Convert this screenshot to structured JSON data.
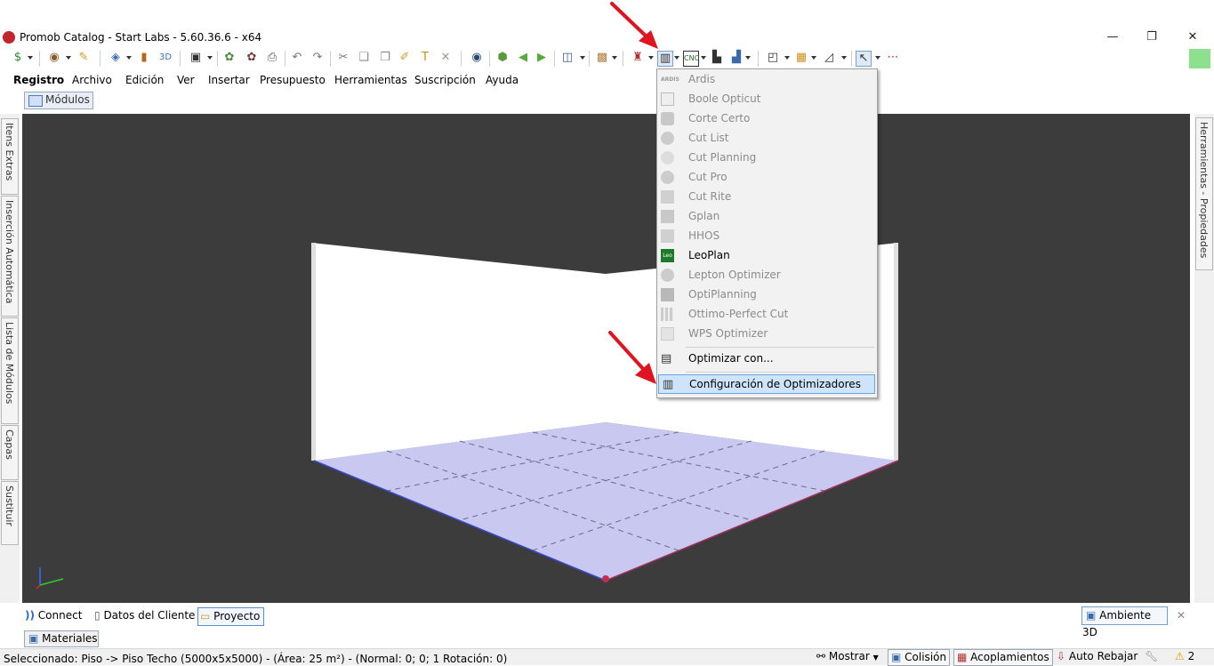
{
  "window": {
    "title": "Promob Catalog - Start Labs - 5.60.36.6 - x64",
    "controls": [
      "—",
      "❐",
      "✕"
    ]
  },
  "menubar": [
    "Registro",
    "Archivo",
    "Edición",
    "Ver",
    "Insertar",
    "Presupuesto",
    "Herramientas",
    "Suscripción",
    "Ayuda"
  ],
  "top_tab": "Módulos",
  "left_tabs": [
    "Itens Extras",
    "Inserción Automática",
    "Lista de Módulos",
    "Capas",
    "Sustituir"
  ],
  "right_tab": "Herramientas - Propiedades",
  "dropdown": {
    "items": [
      {
        "label": "Ardis",
        "enabled": false,
        "icon": "ardis-icon"
      },
      {
        "label": "Boole Opticut",
        "enabled": false,
        "icon": "boole-icon"
      },
      {
        "label": "Corte Certo",
        "enabled": false,
        "icon": "corte-certo-icon"
      },
      {
        "label": "Cut List",
        "enabled": false,
        "icon": "cut-list-icon"
      },
      {
        "label": "Cut Planning",
        "enabled": false,
        "icon": "cut-planning-icon"
      },
      {
        "label": "Cut Pro",
        "enabled": false,
        "icon": "cut-pro-icon"
      },
      {
        "label": "Cut Rite",
        "enabled": false,
        "icon": "cut-rite-icon"
      },
      {
        "label": "Gplan",
        "enabled": false,
        "icon": "gplan-icon"
      },
      {
        "label": "HHOS",
        "enabled": false,
        "icon": "hhos-icon"
      },
      {
        "label": "LeoPlan",
        "enabled": true,
        "icon": "leoplan-icon"
      },
      {
        "label": "Lepton Optimizer",
        "enabled": false,
        "icon": "lepton-icon"
      },
      {
        "label": "OptiPlanning",
        "enabled": false,
        "icon": "optiplanning-icon"
      },
      {
        "label": "Ottimo-Perfect Cut",
        "enabled": false,
        "icon": "ottimo-icon"
      },
      {
        "label": "WPS Optimizer",
        "enabled": false,
        "icon": "wps-icon"
      }
    ],
    "optimize_with": "Optimizar con...",
    "config": "Configuración de Optimizadores",
    "ardis_badge": "ARDIS",
    "leo_badge": "Leo"
  },
  "bottom_tabs": {
    "connect": "Connect",
    "client": "Datos del Cliente",
    "project": "Proyecto",
    "ambiente": "Ambiente 3D",
    "materiales": "Materiales"
  },
  "status": {
    "text": "Seleccionado: Piso -> Piso Techo (5000x5x5000) - (Área: 25 m²) - (Normal: 0; 0; 1 Rotación: 0)",
    "mostrar": "Mostrar",
    "colision": "Colisión",
    "acoplamientos": "Acoplamientos",
    "auto_rebajar": "Auto Rebajar",
    "warnings": "2"
  },
  "colors": {
    "viewport_bg": "#3c3c3c",
    "floor": "#c8c8f0",
    "arrow": "#e0141e",
    "highlight": "#cde4fa"
  }
}
